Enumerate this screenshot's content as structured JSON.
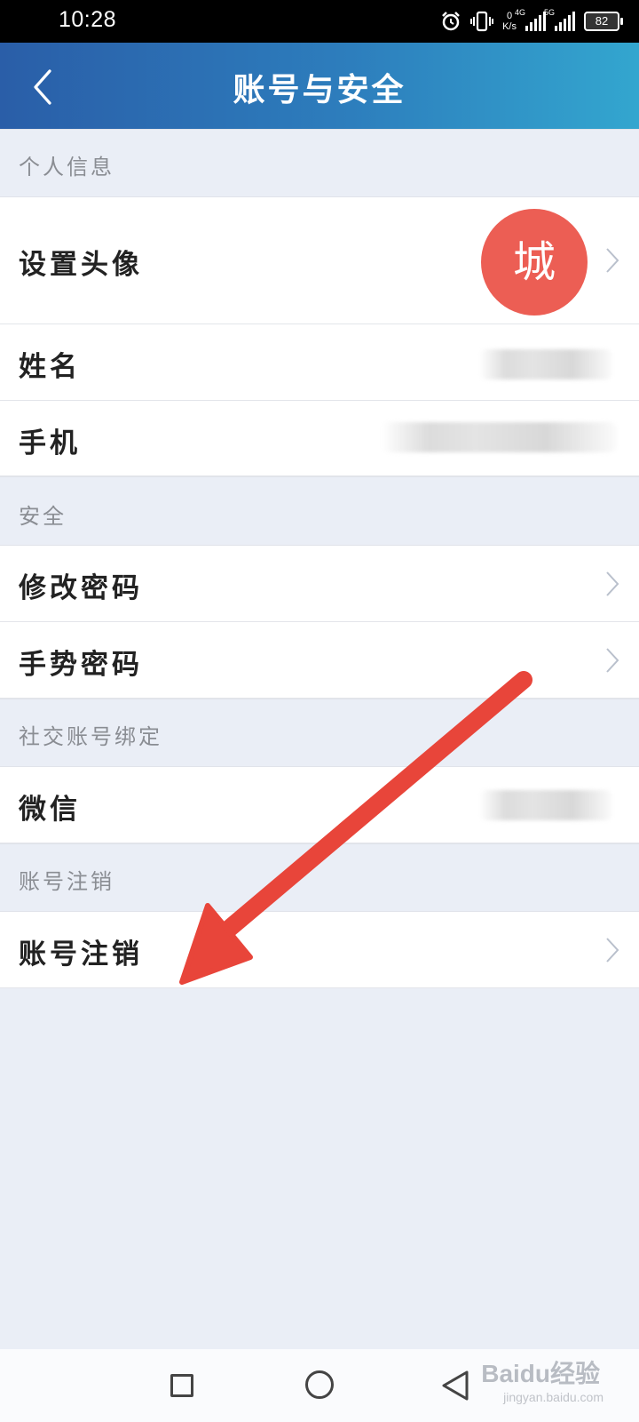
{
  "status_bar": {
    "time": "10:28",
    "speed_value": "0",
    "speed_unit": "K/s",
    "network1": "4G",
    "network2": "5G",
    "battery": "82"
  },
  "header": {
    "title": "账号与安全",
    "back_icon": "chevron-left-icon"
  },
  "sections": {
    "personal": {
      "label": "个人信息",
      "avatar_row": {
        "label": "设置头像",
        "avatar_text": "城"
      },
      "name_row": {
        "label": "姓名"
      },
      "phone_row": {
        "label": "手机"
      }
    },
    "security": {
      "label": "安全",
      "password_row": {
        "label": "修改密码"
      },
      "gesture_row": {
        "label": "手势密码"
      }
    },
    "social": {
      "label": "社交账号绑定",
      "wechat_row": {
        "label": "微信"
      }
    },
    "deactivate": {
      "label": "账号注销",
      "deactivate_row": {
        "label": "账号注销"
      }
    }
  },
  "colors": {
    "header_gradient_start": "#2a5ea8",
    "header_gradient_end": "#33a6cf",
    "avatar_bg": "#ec5e54",
    "arrow": "#e8453a",
    "page_bg": "#eaeef6"
  },
  "bottom_nav": {
    "recent_icon": "square-icon",
    "home_icon": "circle-icon",
    "back_icon": "triangle-back-icon"
  },
  "watermark": {
    "text": "Baidu经验",
    "sub": "jingyan.baidu.com"
  }
}
